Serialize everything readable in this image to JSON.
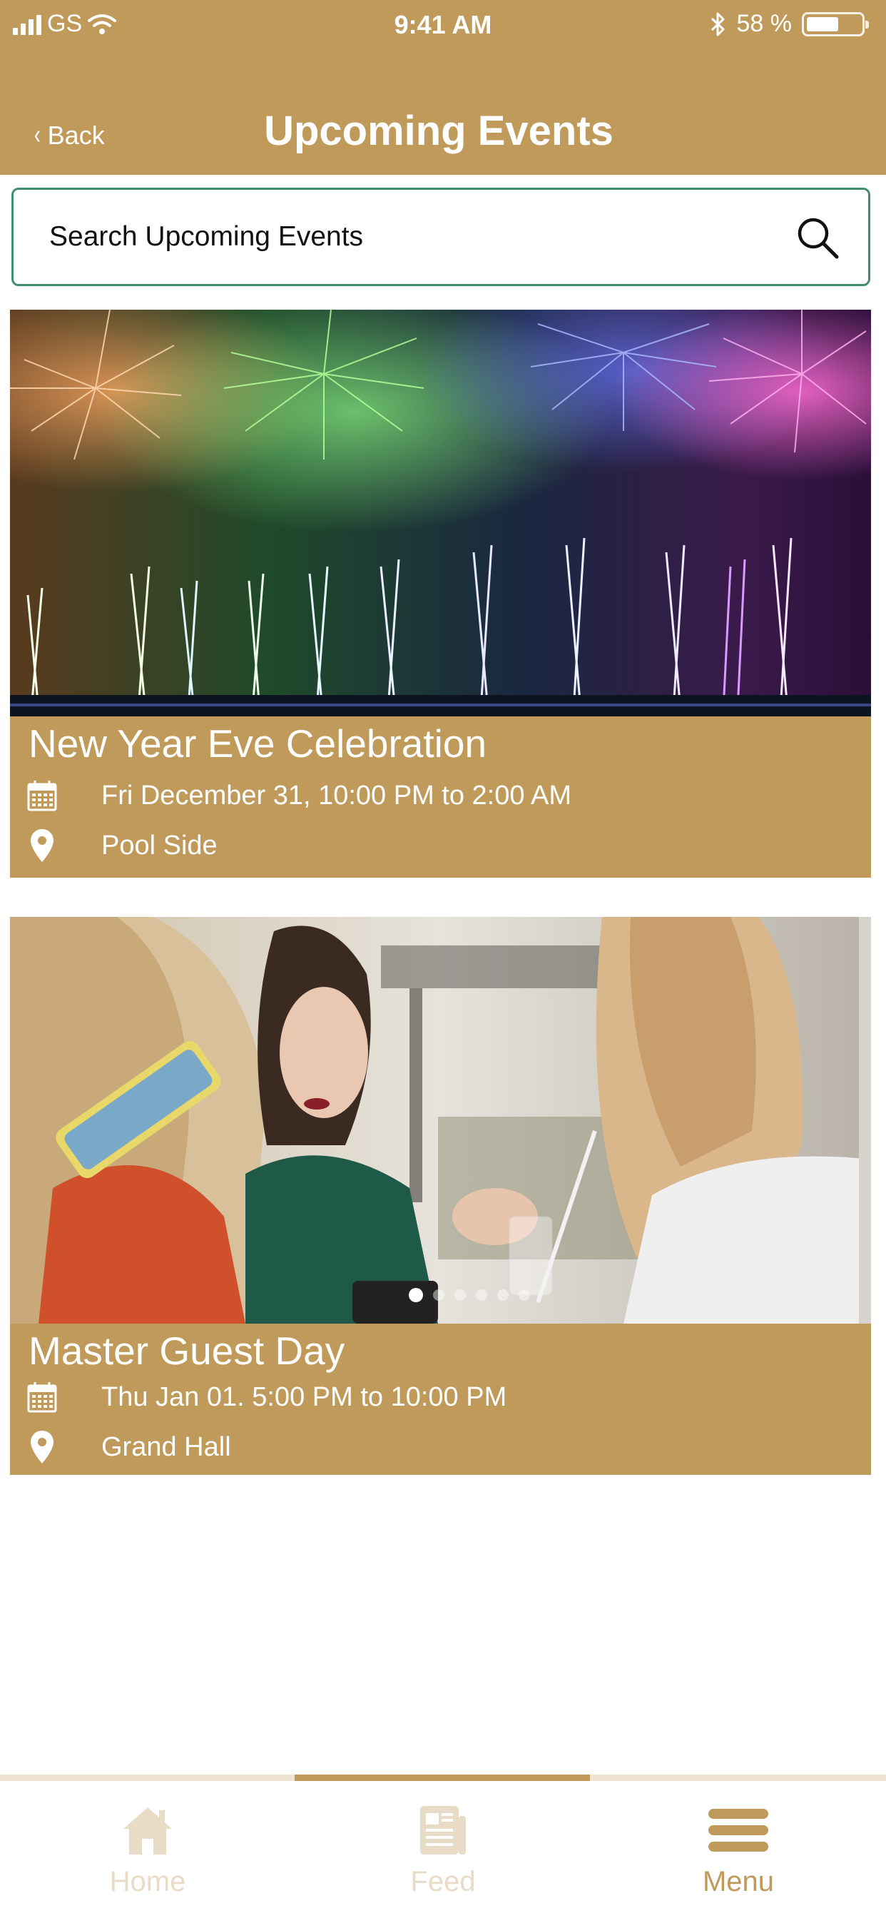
{
  "status_bar": {
    "carrier": "GS",
    "time": "9:41 AM",
    "battery": "58 %",
    "battery_level": 0.58
  },
  "header": {
    "back_label": "Back",
    "title": "Upcoming Events"
  },
  "search": {
    "placeholder": "Search Upcoming Events"
  },
  "events": [
    {
      "title": "New Year Eve Celebration",
      "date": "Fri December 31, 10:00 PM to 2:00 AM",
      "location": "Pool Side"
    },
    {
      "title": "Master Guest Day",
      "date": "Thu Jan 01. 5:00 PM to 10:00 PM",
      "location": "Grand Hall"
    }
  ],
  "tabbar": {
    "home": "Home",
    "feed": "Feed",
    "menu": "Menu"
  },
  "colors": {
    "brand": "#bf9a5a",
    "search_border": "#3f8f6a",
    "inactive_tab": "#e9dcc6"
  }
}
